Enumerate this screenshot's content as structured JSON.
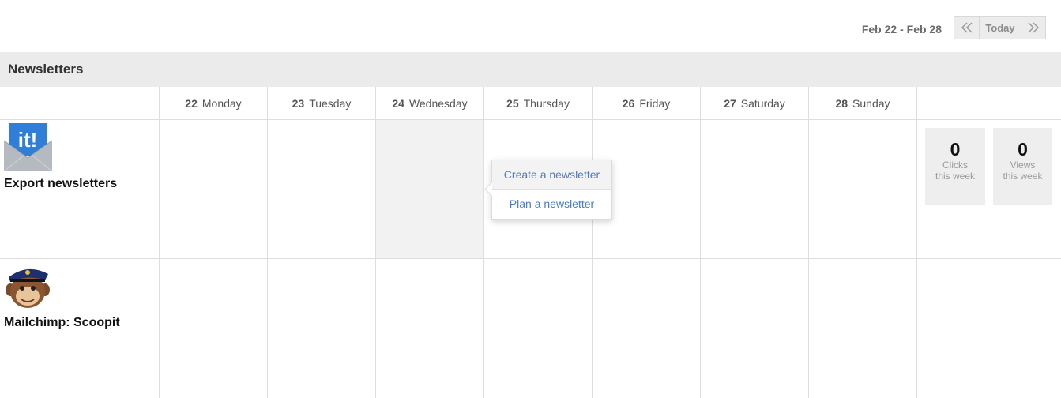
{
  "toolbar": {
    "date_range": "Feb 22 - Feb 28",
    "prev_icon": "double-chevron-left-icon",
    "today_label": "Today",
    "next_icon": "double-chevron-right-icon"
  },
  "section": {
    "title": "Newsletters"
  },
  "days": [
    {
      "num": "22",
      "name": "Monday"
    },
    {
      "num": "23",
      "name": "Tuesday"
    },
    {
      "num": "24",
      "name": "Wednesday"
    },
    {
      "num": "25",
      "name": "Thursday"
    },
    {
      "num": "26",
      "name": "Friday"
    },
    {
      "num": "27",
      "name": "Saturday"
    },
    {
      "num": "28",
      "name": "Sunday"
    }
  ],
  "sources": [
    {
      "name": "Export newsletters",
      "logo_text": "it!",
      "stats": [
        {
          "value": "0",
          "label_line1": "Clicks",
          "label_line2": "this week"
        },
        {
          "value": "0",
          "label_line1": "Views",
          "label_line2": "this week"
        }
      ]
    },
    {
      "name": "Mailchimp: Scoopit"
    }
  ],
  "popup": {
    "create_label": "Create a newsletter",
    "plan_label": "Plan a newsletter"
  },
  "colors": {
    "link": "#4a7bc6",
    "header_bg": "#ebebeb",
    "logo_blue": "#2f7fd8"
  }
}
